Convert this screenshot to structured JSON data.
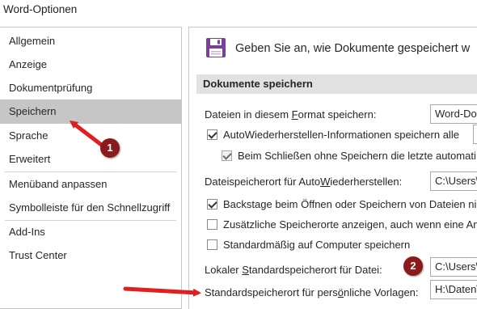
{
  "window": {
    "title": "Word-Optionen"
  },
  "sidebar": {
    "items": [
      {
        "label": "Allgemein",
        "selected": false
      },
      {
        "label": "Anzeige",
        "selected": false
      },
      {
        "label": "Dokumentprüfung",
        "selected": false
      },
      {
        "label": "Speichern",
        "selected": true
      },
      {
        "label": "Sprache",
        "selected": false
      },
      {
        "label": "Erweitert",
        "selected": false
      },
      {
        "label": "Menüband anpassen",
        "selected": false
      },
      {
        "label": "Symbolleiste für den Schnellzugriff",
        "selected": false
      },
      {
        "label": "Add-Ins",
        "selected": false
      },
      {
        "label": "Trust Center",
        "selected": false
      }
    ]
  },
  "main": {
    "header_icon": "floppy-disk-icon",
    "header_text": "Geben Sie an, wie Dokumente gespeichert w",
    "section_title": "Dokumente speichern",
    "format_label": {
      "pre": "Dateien in diesem ",
      "u": "F",
      "post": "ormat speichern:"
    },
    "format_value": "Word-Do",
    "autorecover": {
      "label": "AutoWiederherstellen-Informationen speichern alle",
      "checked": true
    },
    "keep_last": {
      "label": "Beim Schließen ohne Speichern die letzte automati",
      "checked": true,
      "disabled": true
    },
    "autorecover_path_label": {
      "pre": "Dateispeicherort für Auto",
      "u": "W",
      "post": "iederherstellen:"
    },
    "autorecover_path_value": "C:\\Users\\",
    "backstage": {
      "label": "Backstage beim Öffnen oder Speichern von Dateien ni",
      "checked": true
    },
    "additional_locations": {
      "label": "Zusätzliche Speicherorte anzeigen, auch wenn eine An",
      "checked": false
    },
    "computer_default": {
      "label": "Standardmäßig auf Computer speichern",
      "checked": false
    },
    "local_default_label": {
      "pre": "Lokaler ",
      "u": "S",
      "post": "tandardspeicherort für Datei:"
    },
    "local_default_value": "C:\\Users\\",
    "templates_label": {
      "pre": "Standardspeicherort für pers",
      "u": "ö",
      "post": "nliche Vorlagen:"
    },
    "templates_value": "H:\\Daten\\"
  },
  "annotations": {
    "badge1": "1",
    "badge2": "2",
    "arrow_color": "#e02020",
    "badge_color": "#8b1b1b"
  }
}
